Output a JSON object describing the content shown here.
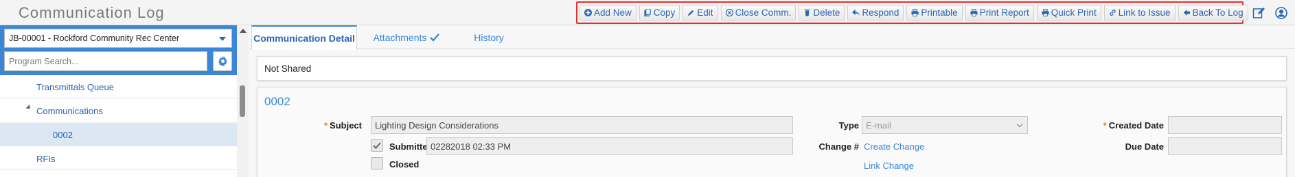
{
  "app": {
    "title": "Communication Log"
  },
  "toolbar": {
    "buttons": [
      {
        "label": "Add New",
        "icon": "plus-circle-icon"
      },
      {
        "label": "Copy",
        "icon": "copy-icon"
      },
      {
        "label": "Edit",
        "icon": "pencil-icon"
      },
      {
        "label": "Close Comm.",
        "icon": "close-circle-icon"
      },
      {
        "label": "Delete",
        "icon": "trash-icon"
      },
      {
        "label": "Respond",
        "icon": "reply-icon"
      },
      {
        "label": "Printable",
        "icon": "print-icon"
      },
      {
        "label": "Print Report",
        "icon": "print-icon"
      },
      {
        "label": "Quick Print",
        "icon": "print-icon"
      },
      {
        "label": "Link to Issue",
        "icon": "link-icon"
      },
      {
        "label": "Back To Log",
        "icon": "arrow-left-icon"
      }
    ]
  },
  "header_icons": {
    "edit": "edit-note-icon",
    "user": "user-circle-icon"
  },
  "sidebar": {
    "project": "JB-00001 - Rockford Community Rec Center",
    "search_placeholder": "Program Search...",
    "items": [
      {
        "label": "Transmittals Queue"
      },
      {
        "label": "Communications"
      },
      {
        "label": "0002"
      },
      {
        "label": "RFIs"
      }
    ]
  },
  "tabs": [
    {
      "label": "Communication Detail"
    },
    {
      "label": "Attachments"
    },
    {
      "label": "History"
    }
  ],
  "sharing_status": "Not Shared",
  "record": {
    "number": "0002",
    "subject_label": "Subject",
    "subject_value": "Lighting Design Considerations",
    "submitted_label": "Submitted",
    "submitted_value": "02282018 02:33 PM",
    "closed_label": "Closed",
    "type_label": "Type",
    "type_value": "E-mail",
    "change_label": "Change #",
    "create_change": "Create Change",
    "link_change": "Link Change",
    "created_date_label": "Created Date",
    "due_date_label": "Due Date"
  },
  "colors": {
    "accent": "#3b86d6",
    "link": "#2a63b3",
    "highlight": "#e0312f",
    "required": "#e08a00"
  }
}
